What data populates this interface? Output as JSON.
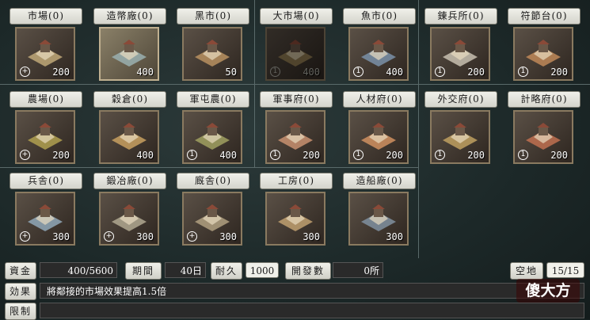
{
  "buildings": [
    {
      "label": "市場(0)",
      "cost": "200",
      "mark": "plus",
      "state": "normal",
      "art": "market"
    },
    {
      "label": "造幣廠(0)",
      "cost": "400",
      "mark": "",
      "state": "selected",
      "art": "mint"
    },
    {
      "label": "黑市(0)",
      "cost": "50",
      "mark": "",
      "state": "normal",
      "art": "blackmarket"
    },
    {
      "label": "大市場(0)",
      "cost": "400",
      "mark": "one",
      "state": "disabled",
      "art": "bigmarket"
    },
    {
      "label": "魚市(0)",
      "cost": "400",
      "mark": "one",
      "state": "normal",
      "art": "fishmarket"
    },
    {
      "label": "錬兵所(0)",
      "cost": "200",
      "mark": "one",
      "state": "normal",
      "art": "drill"
    },
    {
      "label": "符節台(0)",
      "cost": "200",
      "mark": "one",
      "state": "normal",
      "art": "tally"
    },
    {
      "label": "農場(0)",
      "cost": "200",
      "mark": "plus",
      "state": "normal",
      "art": "farm"
    },
    {
      "label": "穀倉(0)",
      "cost": "400",
      "mark": "",
      "state": "normal",
      "art": "granary"
    },
    {
      "label": "軍屯農(0)",
      "cost": "400",
      "mark": "one",
      "state": "normal",
      "art": "militaryfarm"
    },
    {
      "label": "軍事府(0)",
      "cost": "200",
      "mark": "one",
      "state": "normal",
      "art": "militaryoffice"
    },
    {
      "label": "人材府(0)",
      "cost": "200",
      "mark": "one",
      "state": "normal",
      "art": "talentoffice"
    },
    {
      "label": "外交府(0)",
      "cost": "200",
      "mark": "one",
      "state": "normal",
      "art": "diplomacy"
    },
    {
      "label": "計略府(0)",
      "cost": "200",
      "mark": "one",
      "state": "normal",
      "art": "strategy"
    },
    {
      "label": "兵舎(0)",
      "cost": "300",
      "mark": "plus",
      "state": "normal",
      "art": "barracks"
    },
    {
      "label": "鍛冶廠(0)",
      "cost": "300",
      "mark": "plus",
      "state": "normal",
      "art": "smithy"
    },
    {
      "label": "廐舎(0)",
      "cost": "300",
      "mark": "plus",
      "state": "normal",
      "art": "stable"
    },
    {
      "label": "工房(0)",
      "cost": "300",
      "mark": "",
      "state": "normal",
      "art": "workshop"
    },
    {
      "label": "造船廠(0)",
      "cost": "300",
      "mark": "",
      "state": "normal",
      "art": "shipyard"
    }
  ],
  "stats": {
    "funds_label": "資金",
    "funds_value": "400/5600",
    "period_label": "期間",
    "period_value": "40日",
    "durability_label": "耐久",
    "durability_value": "1000",
    "dev_label": "開發數",
    "dev_value": "0所",
    "space_label": "空地",
    "space_value": "15/15",
    "effect_label": "効果",
    "effect_value": "將鄰接的市場效果提高1.5倍",
    "limit_label": "限制",
    "limit_value": ""
  },
  "marks": {
    "plus": "+",
    "one": "1"
  },
  "watermark": "傻大方",
  "colors": {
    "panel": "#1c2828",
    "label_bg": "#e8e8e0",
    "tile_border": "#8a7a60"
  }
}
